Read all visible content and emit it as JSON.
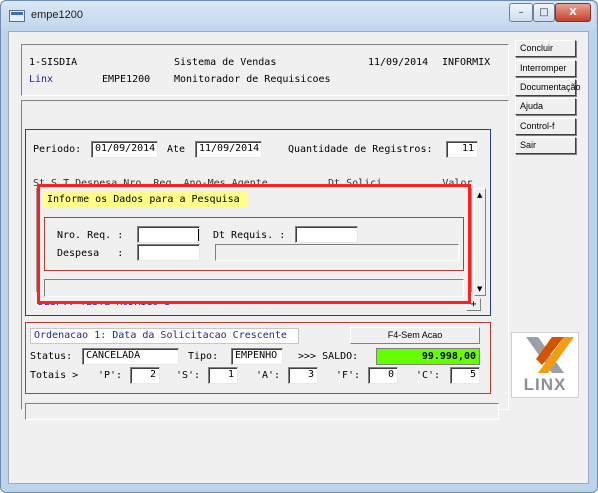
{
  "window": {
    "title": "empe1200"
  },
  "title_controls": {
    "minimize": "–",
    "maximize": "□",
    "close": "X"
  },
  "header": {
    "system": "1-SISDIA",
    "app_name": "Sistema de Vendas",
    "date": "11/09/2014",
    "db": "INFORMIX",
    "brand": "Linx",
    "program": "EMPE1200",
    "subtitle": "Monitorador de Requisicoes"
  },
  "sidebar": {
    "buttons": [
      {
        "label": "Concluir"
      },
      {
        "label": "Interromper"
      },
      {
        "label": "Documentação"
      },
      {
        "label": "Ajuda"
      },
      {
        "label": "Control-f"
      },
      {
        "label": "Sair"
      }
    ]
  },
  "filter": {
    "period_label": "Periodo:",
    "period_from": "01/09/2014",
    "until_label": "Ate",
    "period_to": "11/09/2014",
    "count_label": "Quantidade de Registros:",
    "count_value": "11"
  },
  "grid": {
    "header": "St S T Despesa Nro. Req. Ano-Mes Agente          Dt Solici          Valor",
    "footer": "DESP.: TESTE RODRIGO 3",
    "plus_label": "+"
  },
  "search_dialog": {
    "title": "Informe os Dados para a Pesquisa",
    "req_label": "Nro. Req. :",
    "req_value": "",
    "date_label": "Dt Requis. :",
    "date_value": "",
    "expense_label": "Despesa   :",
    "expense_value": "",
    "expense_desc": "",
    "message": ""
  },
  "summary": {
    "order_text": "Ordenacao 1: Data da Solicitacao Crescente",
    "f4_button": "F4-Sem Acao",
    "status_label": "Status:",
    "status_value": "CANCELADA",
    "type_label": "Tipo:",
    "type_value": "EMPENHO",
    "balance_label": ">>> SALDO:",
    "balance_value": "99.998,00",
    "totals_label": "Totais >",
    "totals": [
      {
        "label": "'P':",
        "value": "2"
      },
      {
        "label": "'S':",
        "value": "1"
      },
      {
        "label": "'A':",
        "value": "3"
      },
      {
        "label": "'F':",
        "value": "0"
      },
      {
        "label": "'C':",
        "value": "5"
      }
    ]
  },
  "status_bar": {
    "text": ""
  },
  "logo": {
    "text": "LINX"
  },
  "colors": {
    "accent_blue": "#1c2a8a",
    "highlight_red": "#ff1f1f",
    "balance_green": "#66ff00",
    "dialog_title_yellow": "#ffff88"
  }
}
